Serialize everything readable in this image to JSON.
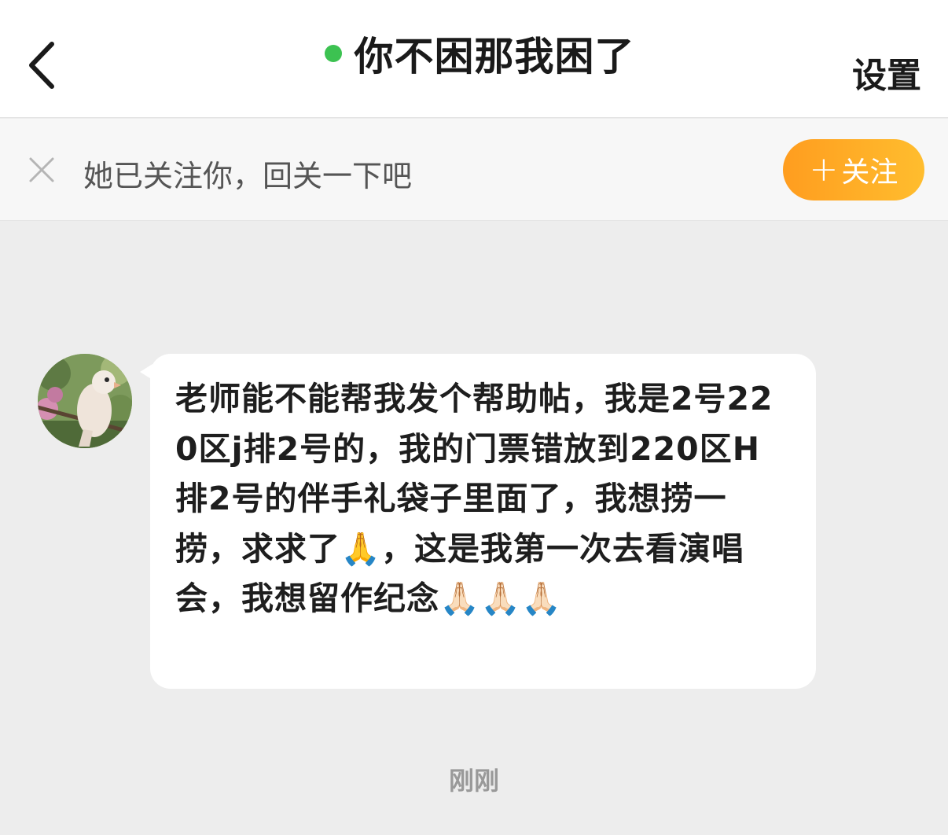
{
  "nav": {
    "title": "你不困那我困了",
    "settings_label": "设置",
    "online_color": "#3cc251"
  },
  "follow_bar": {
    "text": "她已关注你，回关一下吧",
    "follow_plus": "+",
    "follow_label": "关注",
    "button_color": "#ff9d1f"
  },
  "messages": [
    {
      "sender": "other",
      "avatar_icon": "bird-avatar",
      "text": "老师能不能帮我发个帮助帖，我是2号220区j排2号的，我的门票错放到220区H排2号的伴手礼袋子里面了，我想捞一捞，求求了🙏，这是我第一次去看演唱会，我想留作纪念🙏🏻🙏🏻🙏🏻"
    }
  ],
  "timestamp": "刚刚"
}
